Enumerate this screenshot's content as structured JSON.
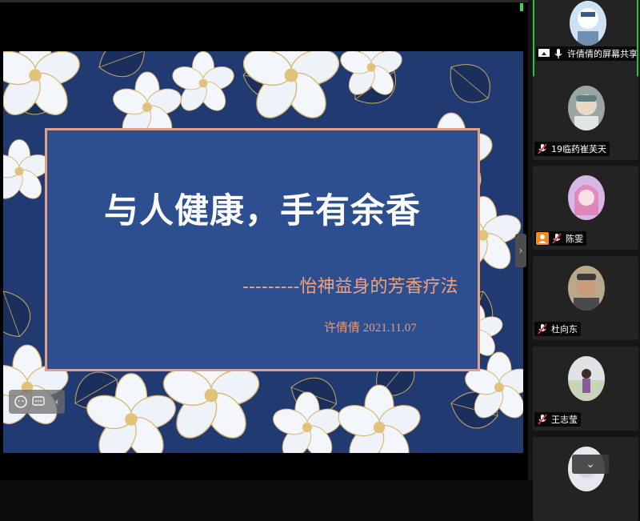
{
  "slide": {
    "title": "与人健康，手有余香",
    "subtitle": "---------怡神益身的芳香疗法",
    "author_date": "许倩倩 2021.11.07"
  },
  "participants": [
    {
      "name": "许倩倩的屏幕共享",
      "status": "screen-share",
      "mic": "on",
      "active": true
    },
    {
      "name": "19临药崔芙天",
      "status": "muted",
      "mic": "muted"
    },
    {
      "name": "陈雯",
      "status": "muted",
      "mic": "muted",
      "host_badge": true
    },
    {
      "name": "杜向东",
      "status": "muted",
      "mic": "muted"
    },
    {
      "name": "王志莹",
      "status": "muted",
      "mic": "muted"
    }
  ],
  "controls": {
    "collapse_glyph": "›",
    "scroll_down_glyph": "⌄",
    "toolbar_back_glyph": "‹"
  },
  "colors": {
    "slide_bg": "#223a72",
    "title_box": "#2e4f8f",
    "title_border": "#e4a184",
    "subtitle_text": "#f1a27d",
    "active_border": "#2fbf4c",
    "mute_red": "#e0333a"
  }
}
